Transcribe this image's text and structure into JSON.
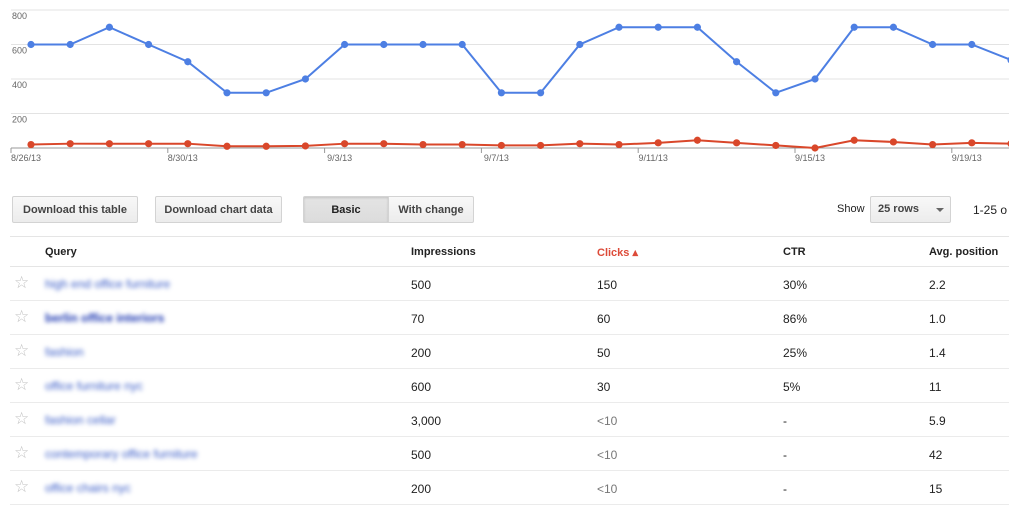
{
  "chart_data": {
    "type": "line",
    "x": [
      "8/26/13",
      "8/27/13",
      "8/28/13",
      "8/29/13",
      "8/30/13",
      "8/31/13",
      "9/1/13",
      "9/2/13",
      "9/3/13",
      "9/4/13",
      "9/5/13",
      "9/6/13",
      "9/7/13",
      "9/8/13",
      "9/9/13",
      "9/10/13",
      "9/11/13",
      "9/12/13",
      "9/13/13",
      "9/14/13",
      "9/15/13",
      "9/16/13",
      "9/17/13",
      "9/18/13",
      "9/19/13",
      "9/20/13"
    ],
    "x_tick_labels": [
      "8/26/13",
      "8/30/13",
      "9/3/13",
      "9/7/13",
      "9/11/13",
      "9/15/13",
      "9/19/13"
    ],
    "y_ticks": [
      "800",
      "600",
      "400",
      "200"
    ],
    "ylim": [
      0,
      800
    ],
    "grid": true,
    "series": [
      {
        "color": "#4d7fe3",
        "values": [
          600,
          600,
          700,
          600,
          500,
          320,
          320,
          400,
          600,
          600,
          600,
          600,
          320,
          320,
          600,
          700,
          700,
          700,
          500,
          320,
          400,
          700,
          700,
          600,
          600,
          510
        ]
      },
      {
        "color": "#d9472a",
        "values": [
          20,
          25,
          25,
          25,
          25,
          10,
          10,
          12,
          25,
          25,
          20,
          20,
          15,
          15,
          25,
          20,
          30,
          45,
          30,
          15,
          0,
          45,
          35,
          20,
          30,
          25
        ]
      }
    ]
  },
  "toolbar": {
    "download_table": "Download this table",
    "download_chart": "Download chart data",
    "basic": "Basic",
    "with_change": "With change",
    "show": "Show",
    "rows": "25 rows",
    "range": "1-25 o"
  },
  "table": {
    "headers": {
      "query": "Query",
      "impressions": "Impressions",
      "clicks": "Clicks ▴",
      "ctr": "CTR",
      "position": "Avg. position"
    },
    "rows": [
      {
        "query": "high end office furniture",
        "impressions": "500",
        "clicks": "150",
        "ctr": "30%",
        "position": "2.2"
      },
      {
        "query": "berlin office interiors",
        "impressions": "70",
        "clicks": "60",
        "ctr": "86%",
        "position": "1.0"
      },
      {
        "query": "fashion",
        "impressions": "200",
        "clicks": "50",
        "ctr": "25%",
        "position": "1.4"
      },
      {
        "query": "office furniture nyc",
        "impressions": "600",
        "clicks": "30",
        "ctr": "5%",
        "position": "11"
      },
      {
        "query": "fashion cellar",
        "impressions": "3,000",
        "clicks": "<10",
        "ctr": "-",
        "position": "5.9"
      },
      {
        "query": "contemporary office furniture",
        "impressions": "500",
        "clicks": "<10",
        "ctr": "-",
        "position": "42"
      },
      {
        "query": "office chairs nyc",
        "impressions": "200",
        "clicks": "<10",
        "ctr": "-",
        "position": "15"
      }
    ]
  }
}
